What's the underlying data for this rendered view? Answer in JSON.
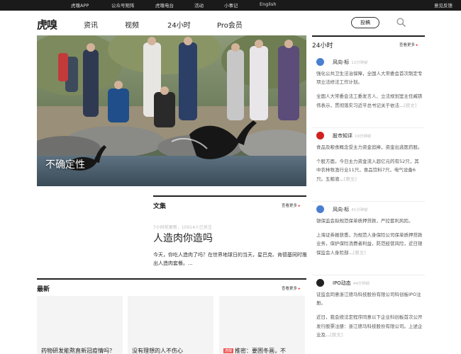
{
  "topbar": {
    "items": [
      "虎嗅APP",
      "公众号矩阵",
      "虎嗅电台",
      "活动",
      "小事记",
      "English"
    ],
    "feedback": "意见反馈"
  },
  "header": {
    "logo": "虎嗅",
    "nav": [
      "资讯",
      "视频",
      "24小时",
      "Pro会员"
    ],
    "contribute": "投稿",
    "search_icon": "search-icon"
  },
  "hero": {
    "caption": "不确定性"
  },
  "feature": {
    "section": "文集",
    "more": "查看更多",
    "meta": "7小时前更新，10914人已关注",
    "title": "人造肉你造吗",
    "desc": "今天，你吃人造肉了吗？在世界地球日的当天，星巴克、肯德基同时推出人造肉套餐。..."
  },
  "latest": {
    "title": "最新",
    "more": "查看更多",
    "cards": [
      {
        "title": "药物研发能熬直新冠疫情吗？",
        "badge": ""
      },
      {
        "title": "没有理想的人不伤心",
        "badge": ""
      },
      {
        "title": "推密：要困冬画，不",
        "badge": "虎嗅"
      }
    ]
  },
  "h24": {
    "title": "24小时",
    "more": "查看更多",
    "entries": [
      {
        "author": "风向·标",
        "time": "12分钟前",
        "avatar_color": "#4a7fd0",
        "paragraphs": [
          "强化公共卫生法治保障，全国人大常委会首次制定专项立法修法工作计划。",
          "全国人大常委会法工委发言人、立法规划室主任臧铁伟表示，贯彻落实习近平总书记关于依法..."
        ],
        "orig": "[原文]"
      },
      {
        "author": "股市知评",
        "time": "19分钟前",
        "avatar_color": "#d02020",
        "paragraphs": [
          "食品及粮食概念受主力资金追捧，资金出逃医药股。",
          "个股方面，今日主力资金流入超亿元的有52只，其中农林牧渔行业11只，食品饮料7只，电气设备6只。五粮液..."
        ],
        "orig": "[原文]"
      },
      {
        "author": "风向·标",
        "time": "41分钟前",
        "avatar_color": "#4a7fd0",
        "paragraphs": [
          "银保监会拟规范保单质押贷款，严控套利风险。",
          "上海证券报获悉，为规范人身保险公司保单质押贷款业务，保护保险消费者利益，防范经营风险，近日银保监会人身险部..."
        ],
        "orig": "[原文]"
      },
      {
        "author": "IPO动态",
        "time": "44分钟前",
        "avatar_color": "#222222",
        "paragraphs": [
          "证监会同意浙江德马科技股份有限公司科创板IPO注册。",
          "近日，我会按法定程序同意以下企业科创板首次公开发行股票注册：浙江德马科技股份有限公司。上述企业及..."
        ],
        "orig": "[原文]"
      }
    ]
  }
}
